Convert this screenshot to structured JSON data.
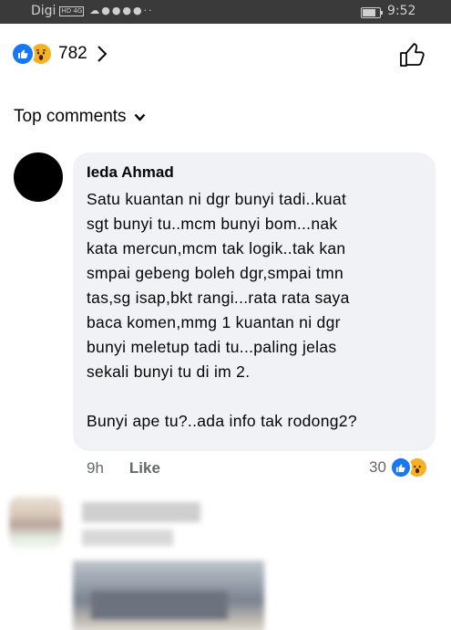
{
  "status_bar": {
    "carrier": "Digi",
    "network_badge": "HD 4G",
    "time": "9:52",
    "battery_level": 0.8
  },
  "post": {
    "reaction_count": "782",
    "reaction_icons": [
      "like-icon",
      "wow-icon"
    ]
  },
  "comments_filter": {
    "label": "Top comments"
  },
  "comment": {
    "author": "Ieda Ahmad",
    "text": "Satu kuantan ni dgr bunyi tadi..kuat\nsgt bunyi tu..mcm bunyi bom...nak\nkata mercun,mcm tak logik..tak kan\nsmpai gebeng boleh dgr,smpai tmn\ntas,sg isap,bkt rangi...rata rata saya\nbaca komen,mmg 1 kuantan ni dgr\nbunyi meletup tadi tu...paling jelas\nsekali bunyi tu di im 2.\n\nBunyi ape tu?..ada info tak rodong2?",
    "timestamp": "9h",
    "like_label": "Like",
    "reaction_count": "30"
  },
  "colors": {
    "facebook_blue": "#1877f2",
    "wow_yellow": "#f7b125",
    "bubble_bg": "#f0f2f5",
    "meta_gray": "#65676b"
  }
}
